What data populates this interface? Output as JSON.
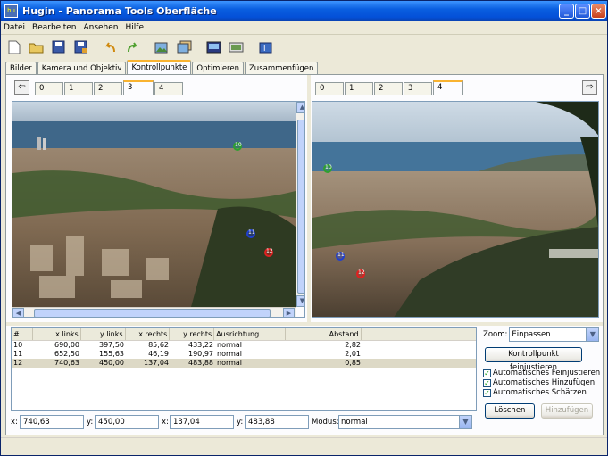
{
  "window": {
    "title": "Hugin - Panorama Tools Oberfläche",
    "app_icon_text": "hu"
  },
  "menu": [
    "Datei",
    "Bearbeiten",
    "Ansehen",
    "Hilfe"
  ],
  "toolbar": [
    "new-document-icon",
    "open-folder-icon",
    "save-icon",
    "save-as-icon",
    "undo-icon",
    "redo-icon",
    "add-image-icon",
    "add-images-icon",
    "preview-icon",
    "panorama-preview-icon",
    "about-icon"
  ],
  "tabs": [
    "Bilder",
    "Kamera und Objektiv",
    "Kontrollpunkte",
    "Optimieren",
    "Zusammenfügen"
  ],
  "active_tab": "Kontrollpunkte",
  "left_pane": {
    "image_tabs": [
      "0",
      "1",
      "2",
      "3",
      "4"
    ],
    "active_image": "3",
    "nav_arrow": "⇦"
  },
  "right_pane": {
    "image_tabs": [
      "0",
      "1",
      "2",
      "3",
      "4"
    ],
    "active_image": "4",
    "nav_arrow": "⇨"
  },
  "control_point_labels": [
    "10",
    "11",
    "12"
  ],
  "table": {
    "headers": [
      "#",
      "x links",
      "y links",
      "x rechts",
      "y rechts",
      "Ausrichtung",
      "Abstand"
    ],
    "rows": [
      [
        "10",
        "690,00",
        "397,50",
        "85,62",
        "433,22",
        "normal",
        "2,82"
      ],
      [
        "11",
        "652,50",
        "155,63",
        "46,19",
        "190,97",
        "normal",
        "2,01"
      ],
      [
        "12",
        "740,63",
        "450,00",
        "137,04",
        "483,88",
        "normal",
        "0,85"
      ]
    ],
    "selected_row": 2
  },
  "zoom": {
    "label": "Zoom:",
    "value": "Einpassen"
  },
  "fine_tune_button": "Kontrollpunkt feinjustieren",
  "checkboxes": [
    "Automatisches Feinjustieren",
    "Automatisches Hinzufügen",
    "Automatisches Schätzen"
  ],
  "delete_button": "Löschen",
  "add_button": "Hinzufügen",
  "bottom": {
    "x1_label": "x:",
    "x1": "740,63",
    "y1_label": "y:",
    "y1": "450,00",
    "x2_label": "x:",
    "x2": "137,04",
    "y2_label": "y:",
    "y2": "483,88",
    "mode_label": "Modus:",
    "mode": "normal"
  },
  "colors": {
    "cp_green": "#2fa02f",
    "cp_blue": "#1f3fd0",
    "cp_red": "#e02020"
  }
}
